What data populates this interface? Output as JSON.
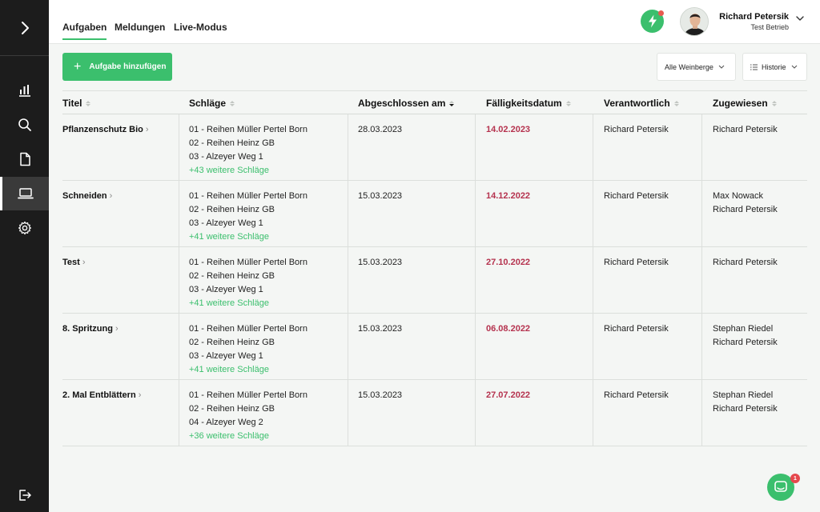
{
  "nav": {
    "tabs": [
      {
        "label": "Aufgaben"
      },
      {
        "label": "Meldungen"
      },
      {
        "label": "Live-Modus"
      }
    ]
  },
  "sidebar": {
    "items": [
      {
        "icon": "chart-icon"
      },
      {
        "icon": "search-icon"
      },
      {
        "icon": "document-icon"
      },
      {
        "icon": "laptop-icon",
        "active": true
      },
      {
        "icon": "gear-icon"
      },
      {
        "icon": "logout-icon"
      }
    ]
  },
  "user": {
    "name": "Richard Petersik",
    "company": "Test Betrieb"
  },
  "toolbar": {
    "add_label": "Aufgabe hinzufügen",
    "vineyard_filter": "Alle Weinberge",
    "history_label": "Historie"
  },
  "table": {
    "columns": [
      "Titel",
      "Schläge",
      "Abgeschlossen am",
      "Fälligkeitsdatum",
      "Verantwortlich",
      "Zugewiesen"
    ],
    "rows": [
      {
        "title": "Pflanzenschutz Bio",
        "plots": [
          "01 - Reihen Müller Pertel Born",
          "02 - Reihen Heinz GB",
          "03 - Alzeyer Weg 1"
        ],
        "more": "+43 weitere Schläge",
        "completed": "28.03.2023",
        "due": "14.02.2023",
        "responsible": "Richard Petersik",
        "assigned": [
          "Richard Petersik"
        ]
      },
      {
        "title": "Schneiden",
        "plots": [
          "01 - Reihen Müller Pertel Born",
          "02 - Reihen Heinz GB",
          "03 - Alzeyer Weg 1"
        ],
        "more": "+41 weitere Schläge",
        "completed": "15.03.2023",
        "due": "14.12.2022",
        "responsible": "Richard Petersik",
        "assigned": [
          "Max Nowack",
          "Richard Petersik"
        ]
      },
      {
        "title": "Test",
        "plots": [
          "01 - Reihen Müller Pertel Born",
          "02 - Reihen Heinz GB",
          "03 - Alzeyer Weg 1"
        ],
        "more": "+41 weitere Schläge",
        "completed": "15.03.2023",
        "due": "27.10.2022",
        "responsible": "Richard Petersik",
        "assigned": [
          "Richard Petersik"
        ]
      },
      {
        "title": "8. Spritzung",
        "plots": [
          "01 - Reihen Müller Pertel Born",
          "02 - Reihen Heinz GB",
          "03 - Alzeyer Weg 1"
        ],
        "more": "+41 weitere Schläge",
        "completed": "15.03.2023",
        "due": "06.08.2022",
        "responsible": "Richard Petersik",
        "assigned": [
          "Stephan Riedel",
          "Richard Petersik"
        ]
      },
      {
        "title": "2. Mal Entblättern",
        "plots": [
          "01 - Reihen Müller Pertel Born",
          "02 - Reihen Heinz GB",
          "04 - Alzeyer Weg 2"
        ],
        "more": "+36 weitere Schläge",
        "completed": "15.03.2023",
        "due": "27.07.2022",
        "responsible": "Richard Petersik",
        "assigned": [
          "Stephan Riedel",
          "Richard Petersik"
        ]
      }
    ]
  },
  "chat": {
    "badge": "1"
  },
  "colors": {
    "accent": "#3bbf6d",
    "overdue": "#b5324e",
    "sidebar": "#1c1c1c"
  }
}
